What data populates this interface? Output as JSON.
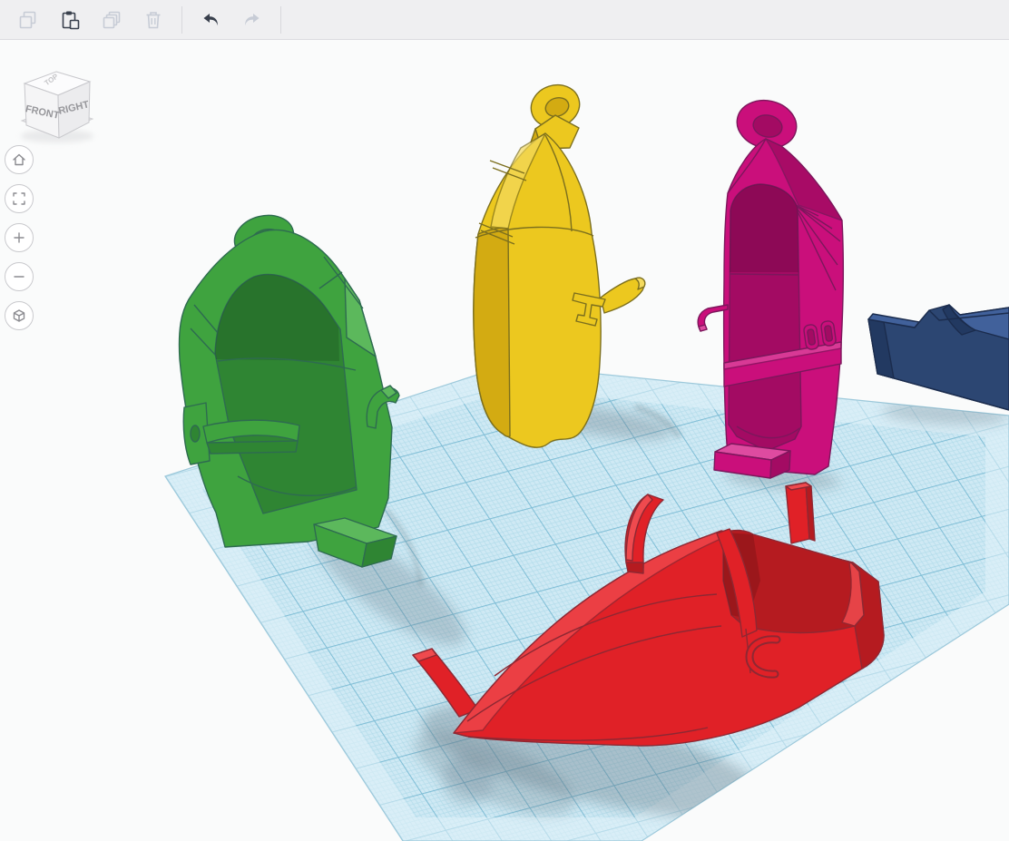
{
  "toolbar": {
    "buttons": [
      {
        "id": "copy",
        "icon": "copy-icon",
        "enabled": false
      },
      {
        "id": "paste",
        "icon": "paste-icon",
        "enabled": true
      },
      {
        "id": "duplicate",
        "icon": "duplicate-icon",
        "enabled": false
      },
      {
        "id": "delete",
        "icon": "trash-icon",
        "enabled": false
      },
      {
        "id": "undo",
        "icon": "undo-arrow-icon",
        "enabled": true
      },
      {
        "id": "redo",
        "icon": "redo-arrow-icon",
        "enabled": false
      }
    ]
  },
  "view_cube": {
    "top_label": "TOP",
    "front_label": "FRONT",
    "right_label": "RIGHT"
  },
  "navigation": {
    "buttons": [
      {
        "id": "home",
        "icon": "home-icon"
      },
      {
        "id": "fit-view",
        "icon": "fit-view-icon"
      },
      {
        "id": "zoom-in",
        "icon": "plus-icon"
      },
      {
        "id": "zoom-out",
        "icon": "minus-icon"
      },
      {
        "id": "perspective-toggle",
        "icon": "perspective-cube-icon"
      }
    ]
  },
  "canvas": {
    "background": "#fafbfb"
  },
  "workplane": {
    "base_color": "#cfe9f4",
    "minor_line_color": "#b2dcea",
    "major_line_color": "#7fbed6",
    "edge_band_color": "#e2f2f9",
    "edge_line_color": "#9dc9db"
  },
  "shadow": {
    "color": "#5f6f7a"
  },
  "scene_objects": [
    {
      "name": "green upright boat keychain",
      "color": "#3fa33f",
      "color_dark": "#2f8533",
      "color_light": "#5cb85c",
      "outline": "#2e6b50"
    },
    {
      "name": "yellow upright boat keychain",
      "color": "#ecc81f",
      "color_dark": "#d3ab12",
      "color_light": "#f4da5e",
      "outline": "#7c6f1e"
    },
    {
      "name": "magenta upright boat keychain",
      "color": "#ca0f7b",
      "color_dark": "#a30b63",
      "color_light": "#de4ba0",
      "outline": "#7c175c"
    },
    {
      "name": "red boat lying flat",
      "color": "#e02127",
      "color_dark": "#b51b20",
      "color_light": "#ef4a4e",
      "outline": "#8e2833"
    },
    {
      "name": "blue boat partially visible",
      "color": "#2c4672",
      "color_dark": "#223961",
      "color_light": "#41619b",
      "outline": "#1b2c4d"
    }
  ]
}
